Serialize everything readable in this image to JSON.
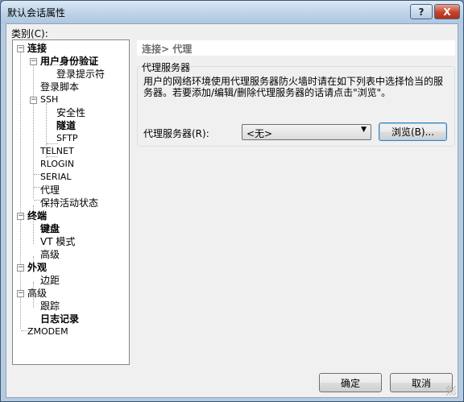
{
  "window": {
    "title": "默认会话属性"
  },
  "titlebar": {
    "help_glyph": "?",
    "close_glyph": "X"
  },
  "category_label": "类别(C):",
  "tree": {
    "connection": "连接",
    "user_auth": "用户身份验证",
    "login_prompts": "登录提示符",
    "login_script": "登录脚本",
    "ssh": "SSH",
    "security": "安全性",
    "tunnel": "隧道",
    "sftp": "SFTP",
    "telnet": "TELNET",
    "rlogin": "RLOGIN",
    "serial": "SERIAL",
    "proxy": "代理",
    "keepalive": "保持活动状态",
    "terminal": "终端",
    "keyboard": "键盘",
    "vt_mode": "VT 模式",
    "terminal_advanced": "高级",
    "appearance": "外观",
    "margins": "边距",
    "advanced": "高级",
    "trace": "跟踪",
    "logging": "日志记录",
    "zmodem": "ZMODEM",
    "expander_minus": "−"
  },
  "page": {
    "header": "连接> 代理",
    "group_title": "代理服务器",
    "description": "用户的网络环境使用代理服务器防火墙时请在如下列表中选择恰当的服务器。若要添加/编辑/删除代理服务器的话请点击\"浏览\"。",
    "proxy_label": "代理服务器(R):",
    "proxy_value": "<无>",
    "browse_button": "浏览(B)...",
    "combo_arrow": "▼"
  },
  "footer": {
    "ok": "确定",
    "cancel": "取消"
  }
}
